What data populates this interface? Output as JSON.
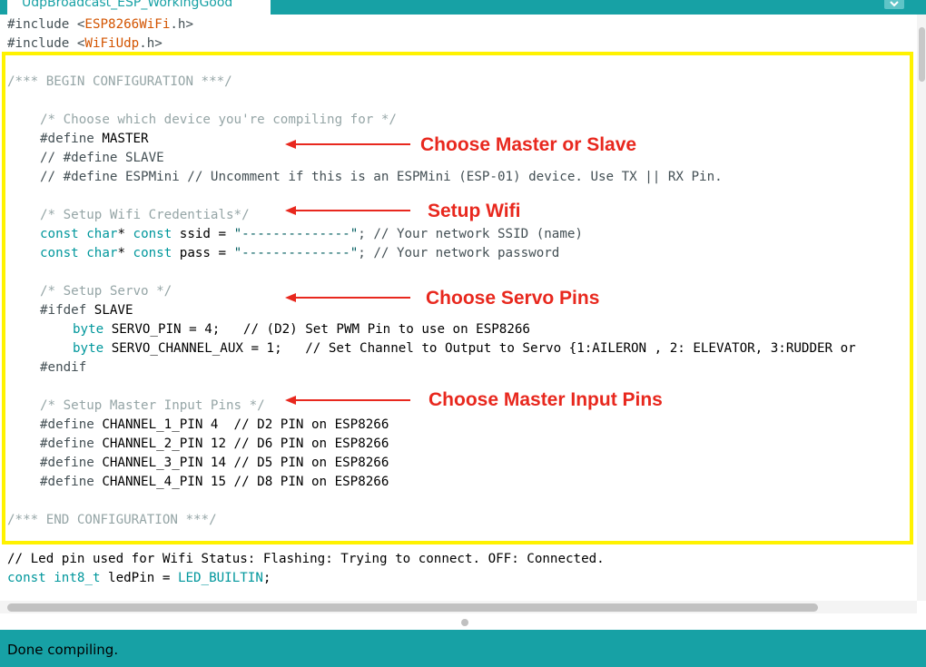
{
  "window": {
    "tab_title": "UdpBroadcast_ESP_WorkingGood"
  },
  "code": {
    "l1": [
      "#include <",
      "ESP8266WiFi",
      ".h>"
    ],
    "l2": [
      "#include <",
      "WiFiUdp",
      ".h>"
    ],
    "l4": "/*** BEGIN CONFIGURATION ***/",
    "l6": "/* Choose which device you're compiling for */",
    "l7": [
      "#define",
      " MASTER"
    ],
    "l8": "// #define SLAVE",
    "l9": "// #define ESPMini // Uncomment if this is an ESPMini (ESP-01) device. Use TX || RX Pin.",
    "l11": "/* Setup Wifi Credentials*/",
    "l12": [
      "const",
      " ",
      "char",
      "* ",
      "const",
      " ssid = ",
      "\"--------------\"",
      "; // Your network SSID (name)"
    ],
    "l13": [
      "const",
      " ",
      "char",
      "* ",
      "const",
      " pass = ",
      "\"--------------\"",
      "; // Your network password"
    ],
    "l15": "/* Setup Servo */",
    "l16": [
      "#ifdef",
      " SLAVE"
    ],
    "l17": [
      "byte",
      " SERVO_PIN = 4;   // (D2) Set PWM Pin to use on ESP8266"
    ],
    "l18": [
      "byte",
      " SERVO_CHANNEL_AUX = 1;   // Set Channel to Output to Servo {1:AILERON , 2: ELEVATOR, 3:RUDDER or"
    ],
    "l19": "#endif",
    "l21": "/* Setup Master Input Pins */",
    "l22": [
      "#define",
      " CHANNEL_1_PIN 4  // D2 PIN on ESP8266"
    ],
    "l23": [
      "#define",
      " CHANNEL_2_PIN 12 // D6 PIN on ESP8266"
    ],
    "l24": [
      "#define",
      " CHANNEL_3_PIN 14 // D5 PIN on ESP8266"
    ],
    "l25": [
      "#define",
      " CHANNEL_4_PIN 15 // D8 PIN on ESP8266"
    ],
    "l27": "/*** END CONFIGURATION ***/",
    "l29": "// Led pin used for Wifi Status: Flashing: Trying to connect. OFF: Connected.",
    "l30": [
      "const",
      " ",
      "int8_t",
      " ledPin = ",
      "LED_BUILTIN",
      ";"
    ]
  },
  "annotations": {
    "a1": "Choose Master or Slave",
    "a2": "Setup Wifi",
    "a3": "Choose Servo Pins",
    "a4": "Choose Master Input Pins"
  },
  "status": {
    "message": "Done compiling."
  },
  "colors": {
    "accent": "#17a1a5",
    "highlight": "#fff200",
    "annotation": "#e8281e"
  }
}
